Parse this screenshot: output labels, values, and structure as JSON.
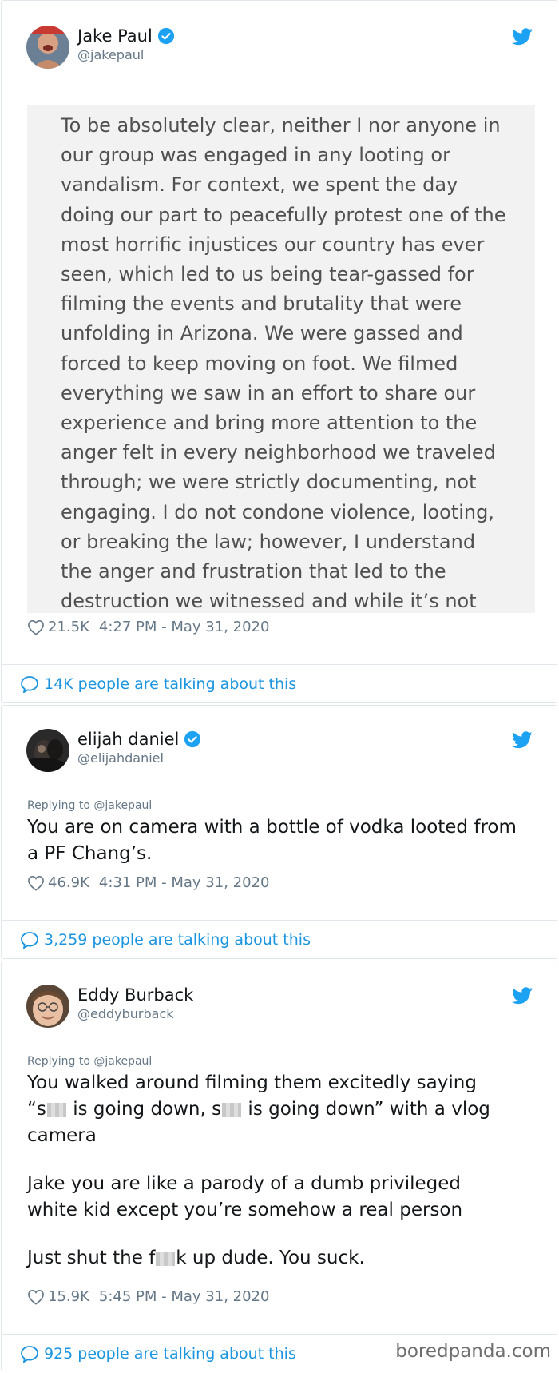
{
  "tweets": [
    {
      "name": "Jake Paul",
      "handle": "@jakepaul",
      "image_text": "To be absolutely clear, neither I nor anyone in our group was engaged in any looting or vandalism. For context, we spent the day doing our part to peacefully protest one of the most horrific injustices our country has ever seen, which led to us being tear-gassed for filming the events and brutality that were unfolding in Arizona. We were gassed and forced to keep moving on foot. We filmed everything we saw in an effort to share our experience and bring more attention to the anger felt in every neighborhood we traveled through; we were strictly documenting, not engaging. I do not condone violence, looting, or breaking the law; however, I understand the anger and frustration that led to the destruction we witnessed and while it’s not the",
      "likes": "21.5K",
      "time": "4:27 PM - May 31, 2020",
      "talking": "14K people are talking about this"
    },
    {
      "name": "elijah daniel",
      "handle": "@elijahdaniel",
      "reply_to": "Replying to @jakepaul",
      "text": "You are on camera with a bottle of vodka looted from a PF Chang’s.",
      "likes": "46.9K",
      "time": "4:31 PM - May 31, 2020",
      "talking": "3,259 people are talking about this"
    },
    {
      "name": "Eddy Burback",
      "handle": "@eddyburback",
      "reply_to": "Replying to @jakepaul",
      "text_parts": {
        "line1": "You walked around filming them excitedly saying",
        "q_open": "“s",
        "mid1": " is going down, s",
        "mid2": " is going down” with a vlog camera",
        "para2": "Jake you are like a parody of a dumb privileged white kid except you’re somehow a real person",
        "p3a": "Just shut the f",
        "p3b": "k up dude. You suck."
      },
      "likes": "15.9K",
      "time": "5:45 PM - May 31, 2020",
      "talking": "925 people are talking about this"
    }
  ],
  "watermark": "boredpanda.com",
  "colors": {
    "link_blue": "#1b95e0",
    "twitter_blue": "#1da1f2",
    "muted": "#657786"
  }
}
